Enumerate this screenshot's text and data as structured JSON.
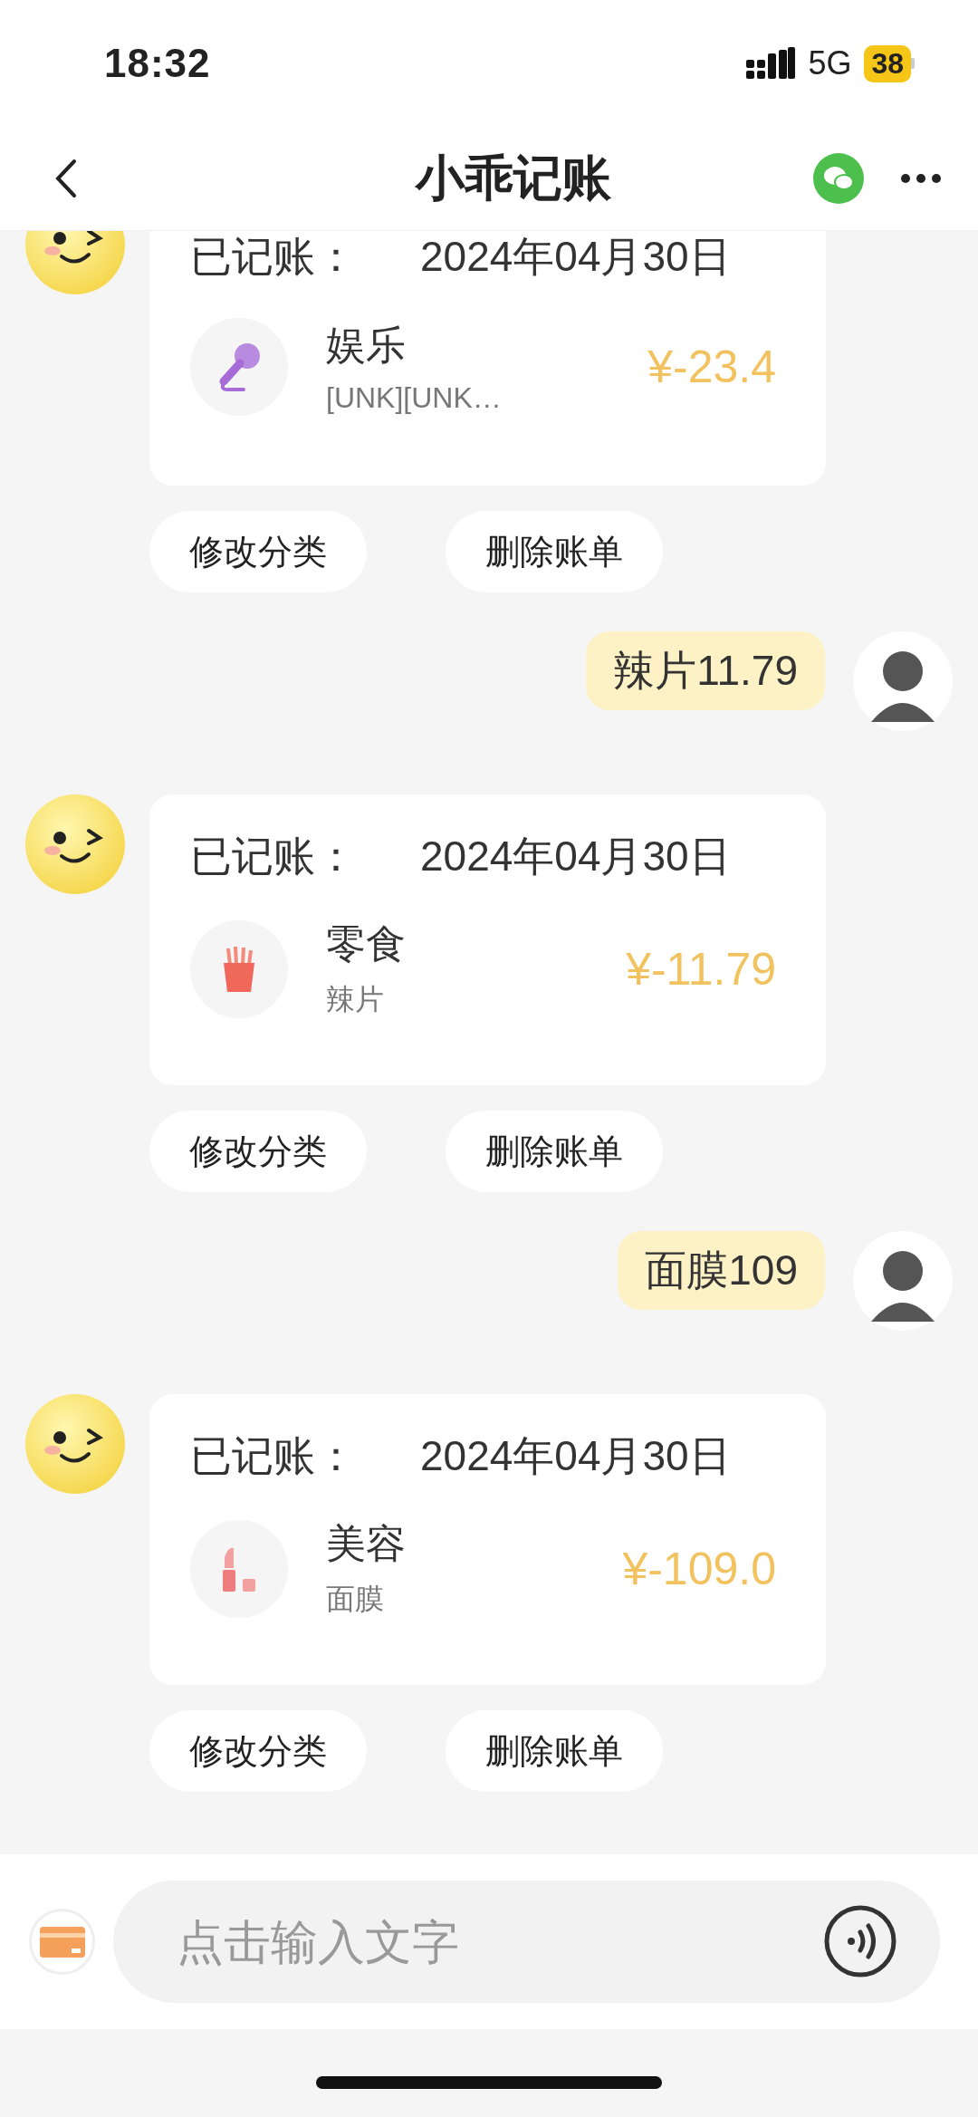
{
  "status_bar": {
    "time": "18:32",
    "network": "5G",
    "battery": "38"
  },
  "header": {
    "title": "小乖记账"
  },
  "messages": [
    {
      "kind": "record",
      "label": "已记账：",
      "date": "2024年04月30日",
      "category": "娱乐",
      "note": "[UNK][UNK…",
      "amount": "¥-23.4",
      "actions": [
        "修改分类",
        "删除账单"
      ]
    },
    {
      "kind": "user",
      "text": "辣片11.79"
    },
    {
      "kind": "record",
      "label": "已记账：",
      "date": "2024年04月30日",
      "category": "零食",
      "note": "辣片",
      "amount": "¥-11.79",
      "actions": [
        "修改分类",
        "删除账单"
      ]
    },
    {
      "kind": "user",
      "text": "面膜109"
    },
    {
      "kind": "record",
      "label": "已记账：",
      "date": "2024年04月30日",
      "category": "美容",
      "note": "面膜",
      "amount": "¥-109.0",
      "actions": [
        "修改分类",
        "删除账单"
      ]
    }
  ],
  "input": {
    "placeholder": "点击输入文字"
  }
}
